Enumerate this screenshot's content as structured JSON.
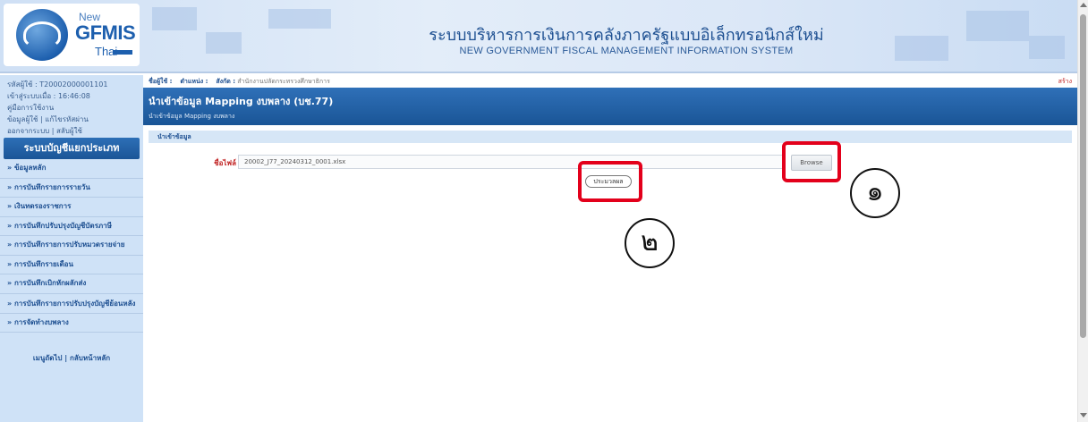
{
  "logo": {
    "new": "New",
    "name": "GFMIS",
    "thai": "Thai"
  },
  "system": {
    "title_th": "ระบบบริหารการเงินการคลังภาครัฐแบบอิเล็กทรอนิกส์ใหม่",
    "title_en": "NEW GOVERNMENT FISCAL MANAGEMENT INFORMATION SYSTEM"
  },
  "sidebar": {
    "user_id_label": "รหัสผู้ใช้ :",
    "user_id": "T20002000001101",
    "login_time_label": "เข้าสู่ระบบเมื่อ :",
    "login_time": "16:46:08",
    "manual_link": "คู่มือการใช้งาน",
    "user_info_link": "ข้อมูลผู้ใช้",
    "edit_profile_link": "แก้ไขรหัสผ่าน",
    "logout_link": "ออกจากระบบ",
    "switch_user_link": "สลับผู้ใช้",
    "header": "ระบบบัญชีแยกประเภท",
    "items": [
      {
        "label": "» ข้อมูลหลัก"
      },
      {
        "label": "» การบันทึกรายการรายวัน"
      },
      {
        "label": "» เงินทดรองราชการ"
      },
      {
        "label": "» การบันทึกปรับปรุงบัญชีบัตรภาษี"
      },
      {
        "label": "» การบันทึกรายการปรับหมวดรายจ่าย"
      },
      {
        "label": "» การบันทึกรายเดือน"
      },
      {
        "label": "» การบันทึกเบิกหักผลักส่ง"
      },
      {
        "label": "» การบันทึกรายการปรับปรุงบัญชีย้อนหลัง"
      },
      {
        "label": "» การจัดทำงบพลาง"
      }
    ],
    "footer_next": "เมนูถัดไป",
    "footer_home": "กลับหน้าหลัก"
  },
  "userbar": {
    "user_label": "ชื่อผู้ใช้ :",
    "position_label": "ตำแหน่ง :",
    "agency_label": "สังกัด :",
    "agency": "สำนักงานปลัดกระทรวงศึกษาธิการ",
    "right_link": "สร้าง"
  },
  "page": {
    "title": "นำเข้าข้อมูล Mapping งบพลาง (บช.77)",
    "breadcrumb": "นำเข้าข้อมูล Mapping งบพลาง",
    "section": "นำเข้าข้อมูล",
    "file_label": "ชื่อไฟล์",
    "file_value": "20002_J77_20240312_0001.xlsx",
    "browse_label": "Browse",
    "process_label": "ประมวลผล"
  },
  "annotations": {
    "one": "๑",
    "two": "๒"
  },
  "colors": {
    "highlight": "#e3001b",
    "title_bar": "#1a5596",
    "sidebar_bg": "#cfe2f7"
  }
}
